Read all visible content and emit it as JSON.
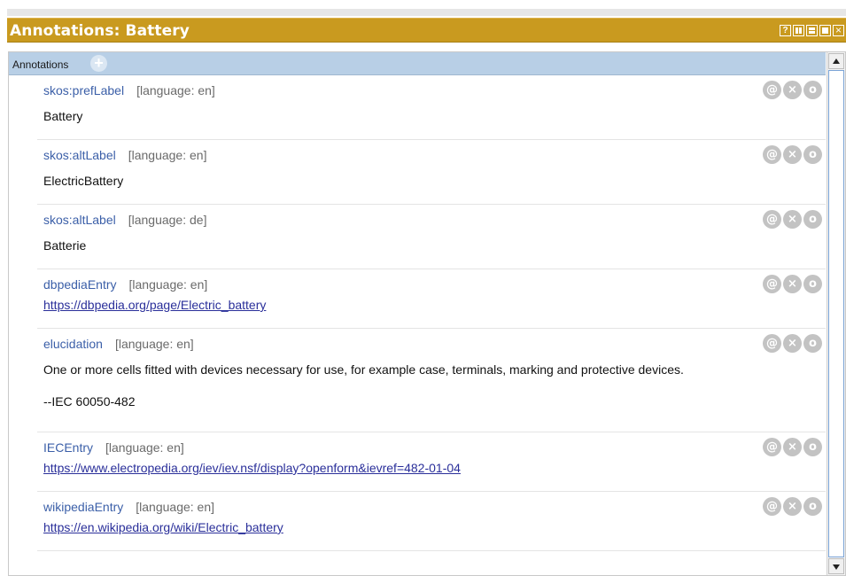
{
  "window": {
    "title": "Annotations: Battery",
    "controls": {
      "help": "?"
    }
  },
  "section": {
    "title": "Annotations",
    "add_symbol": "+"
  },
  "icons": {
    "annotate": "@",
    "remove": "×",
    "edit": "o"
  },
  "annotations": [
    {
      "property": "skos:prefLabel",
      "language": "[language: en]",
      "value": "Battery",
      "is_link": false
    },
    {
      "property": "skos:altLabel",
      "language": "[language: en]",
      "value": "ElectricBattery",
      "is_link": false
    },
    {
      "property": "skos:altLabel",
      "language": "[language: de]",
      "value": "Batterie",
      "is_link": false
    },
    {
      "property": "dbpediaEntry",
      "language": "[language: en]",
      "value": "https://dbpedia.org/page/Electric_battery",
      "is_link": true
    },
    {
      "property": "elucidation",
      "language": "[language: en]",
      "value": "One or more cells fitted with devices necessary for use, for example case, terminals, marking and protective devices.",
      "value_extra": "--IEC 60050-482",
      "is_link": false
    },
    {
      "property": "IECEntry",
      "language": "[language: en]",
      "value": "https://www.electropedia.org/iev/iev.nsf/display?openform&ievref=482-01-04",
      "is_link": true
    },
    {
      "property": "wikipediaEntry",
      "language": "[language: en]",
      "value": "https://en.wikipedia.org/wiki/Electric_battery",
      "is_link": true
    }
  ],
  "colors": {
    "titlebar": "#c99a1f",
    "section_header": "#b8cfe6",
    "property": "#3b5fa8",
    "link": "#2a2f9a",
    "action_button": "#c3c3c3"
  }
}
